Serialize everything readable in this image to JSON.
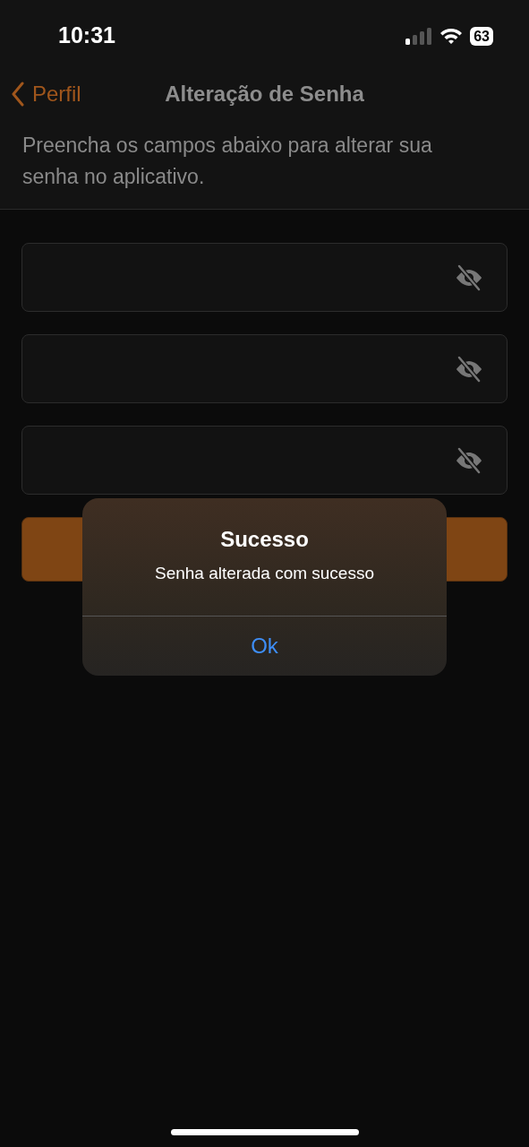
{
  "status_bar": {
    "time": "10:31",
    "battery": "63"
  },
  "nav": {
    "back_label": "Perfil",
    "title": "Alteração de Senha"
  },
  "description": "Preencha os campos abaixo para alterar sua senha no aplicativo.",
  "fields": [
    {
      "masked": true
    },
    {
      "masked": true
    },
    {
      "masked": true
    }
  ],
  "submit_button": {
    "visible": true
  },
  "alert": {
    "title": "Sucesso",
    "message": "Senha alterada com sucesso",
    "button": "Ok"
  }
}
